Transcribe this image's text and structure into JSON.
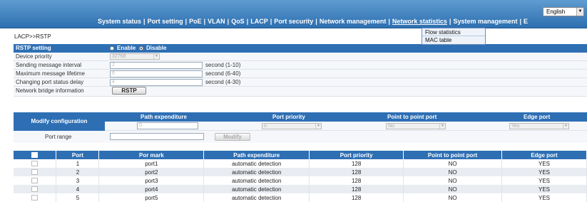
{
  "header": {
    "language": "English",
    "nav": [
      "System status",
      "Port setting",
      "PoE",
      "VLAN",
      "QoS",
      "LACP",
      "Port security",
      "Network management",
      "Network statistics",
      "System management",
      "E"
    ],
    "active_nav": "Network statistics",
    "dropdown": [
      "Flow statistics",
      "MAC table"
    ]
  },
  "breadcrumb": "LACP>>RSTP",
  "rstp": {
    "section_label": "RSTP setting",
    "enable_label": "Enable",
    "disable_label": "Disable",
    "selected": "Disable",
    "device_priority_label": "Device priority",
    "device_priority_value": "32768",
    "sending_interval_label": "Sending message interval",
    "sending_interval_value": "2",
    "sending_interval_hint": "second (1-10)",
    "max_lifetime_label": "Maximum message lifetime",
    "max_lifetime_value": "6",
    "max_lifetime_hint": "second (6-40)",
    "change_delay_label": "Changing port status delay",
    "change_delay_value": "4",
    "change_delay_hint": "second (4-30)",
    "bridge_info_label": "Network bridge information",
    "bridge_button": "RSTP"
  },
  "modify": {
    "label": "Modify configuration",
    "columns": [
      "Path expenditure",
      "Port priority",
      "Point to point port",
      "Edge port"
    ],
    "path_value": "0",
    "priority_value": "n",
    "p2p_value": "No",
    "edge_value": "Yes",
    "port_range_label": "Port range",
    "modify_button": "Modify"
  },
  "ports": {
    "headers": [
      "Port",
      "Por mark",
      "Path expenditure",
      "Port priority",
      "Point to point port",
      "Edge port"
    ],
    "rows": [
      [
        "1",
        "port1",
        "automatic detection",
        "128",
        "NO",
        "YES"
      ],
      [
        "2",
        "port2",
        "automatic detection",
        "128",
        "NO",
        "YES"
      ],
      [
        "3",
        "port3",
        "automatic detection",
        "128",
        "NO",
        "YES"
      ],
      [
        "4",
        "port4",
        "automatic detection",
        "128",
        "NO",
        "YES"
      ],
      [
        "5",
        "port5",
        "automatic detection",
        "128",
        "NO",
        "YES"
      ]
    ]
  }
}
